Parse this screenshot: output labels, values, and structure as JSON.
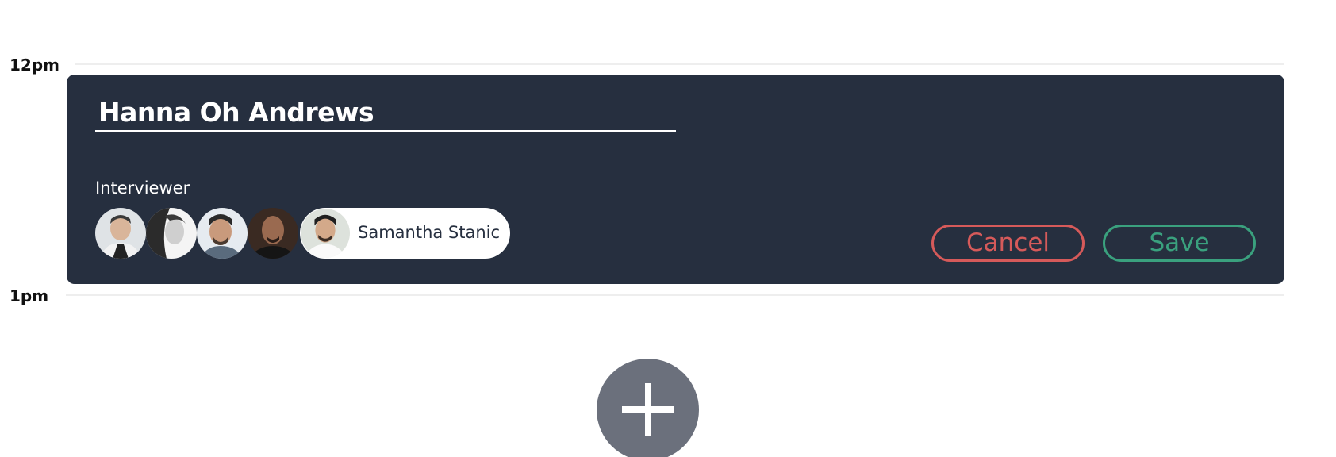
{
  "timeline": {
    "hour_12": "12pm",
    "hour_1": "1pm"
  },
  "event": {
    "candidate_name": "Hanna Oh Andrews",
    "interviewer_label": "Interviewer",
    "interviewers": [
      {
        "icon": "person-avatar-1"
      },
      {
        "icon": "person-avatar-2"
      },
      {
        "icon": "person-avatar-3"
      },
      {
        "icon": "person-avatar-4"
      }
    ],
    "selected_interviewer": "Samantha Stanic",
    "cancel_label": "Cancel",
    "save_label": "Save"
  },
  "colors": {
    "card_background": "#262f3f",
    "cancel": "#d65a5a",
    "save": "#3aa17e",
    "add_button": "#6b707c"
  },
  "add_button": {
    "icon": "plus-icon"
  }
}
